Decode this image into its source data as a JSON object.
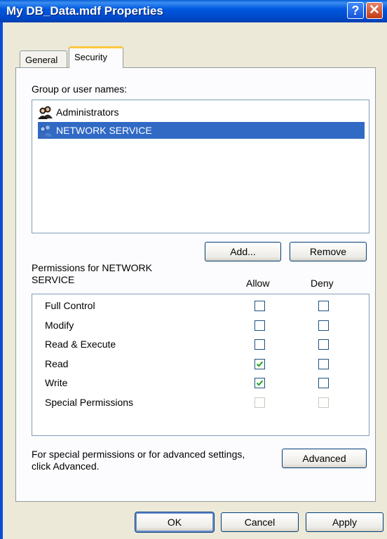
{
  "window": {
    "title": "My DB_Data.mdf Properties"
  },
  "titlebar": {
    "help_glyph": "?",
    "close_glyph": "✕"
  },
  "tabs": [
    {
      "label": "General"
    },
    {
      "label": "Security"
    }
  ],
  "security": {
    "group_label": "Group or user names:",
    "users": [
      {
        "name": "Administrators",
        "icon": "users-group-icon",
        "selected": false
      },
      {
        "name": "NETWORK SERVICE",
        "icon": "users-group-icon",
        "selected": true
      }
    ],
    "add_button": "Add...",
    "remove_button": "Remove",
    "permissions_label_line1": "Permissions for NETWORK",
    "permissions_label_line2": "SERVICE",
    "allow_header": "Allow",
    "deny_header": "Deny",
    "permissions": [
      {
        "name": "Full Control",
        "allow": false,
        "deny": false,
        "enabled": true
      },
      {
        "name": "Modify",
        "allow": false,
        "deny": false,
        "enabled": true
      },
      {
        "name": "Read & Execute",
        "allow": false,
        "deny": false,
        "enabled": true
      },
      {
        "name": "Read",
        "allow": true,
        "deny": false,
        "enabled": true
      },
      {
        "name": "Write",
        "allow": true,
        "deny": false,
        "enabled": true
      },
      {
        "name": "Special Permissions",
        "allow": false,
        "deny": false,
        "enabled": false
      }
    ],
    "advanced_text_line1": "For special permissions or for advanced settings,",
    "advanced_text_line2": "click Advanced.",
    "advanced_button": "Advanced"
  },
  "footer": {
    "ok_button": "OK",
    "cancel_button": "Cancel",
    "apply_button": "Apply"
  },
  "colors": {
    "selection": "#316AC5",
    "check": "#21A121",
    "titlebar": "#0058E0"
  }
}
